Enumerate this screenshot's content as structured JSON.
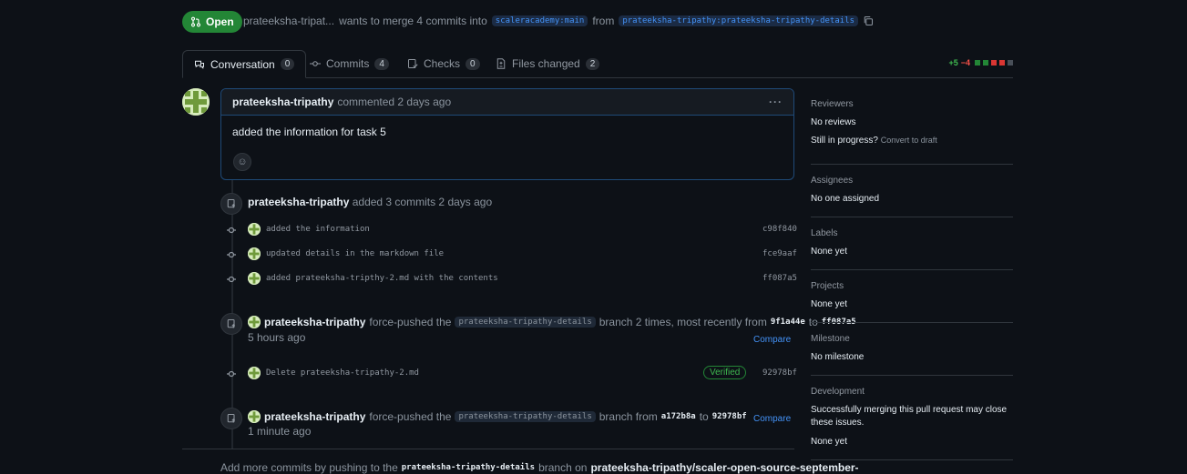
{
  "header": {
    "state": "Open",
    "author": "prateeksha-tripat...",
    "merge_text": "wants to merge 4 commits into",
    "base_branch": "scaleracademy:main",
    "from_text": "from",
    "head_branch": "prateeksha-tripathy:prateeksha-tripathy-details"
  },
  "tabs": [
    {
      "label": "Conversation",
      "count": "0"
    },
    {
      "label": "Commits",
      "count": "4"
    },
    {
      "label": "Checks",
      "count": "0"
    },
    {
      "label": "Files changed",
      "count": "2"
    }
  ],
  "diffstat": {
    "additions": "+5",
    "deletions": "−4"
  },
  "comment": {
    "author": "prateeksha-tripathy",
    "meta": "commented 2 days ago",
    "body": "added the information for task 5"
  },
  "commit_group": {
    "author": "prateeksha-tripathy",
    "meta": "added 3 commits 2 days ago",
    "commits": [
      {
        "message": "added the information",
        "sha": "c98f840"
      },
      {
        "message": "updated details in the markdown file",
        "sha": "fce9aaf"
      },
      {
        "message": "added prateeksha-tripthy-2.md with the contents",
        "sha": "ff087a5"
      }
    ]
  },
  "force_push_1": {
    "author": "prateeksha-tripathy",
    "action": "force-pushed the",
    "branch": "prateeksha-tripathy-details",
    "middle": "branch 2 times, most recently from",
    "from_sha": "9f1a44e",
    "to_text": "to",
    "to_sha": "ff087a5",
    "time": "5 hours ago",
    "compare": "Compare"
  },
  "single_commit": {
    "message": "Delete prateeksha-tripathy-2.md",
    "verified": "Verified",
    "sha": "92978bf"
  },
  "force_push_2": {
    "author": "prateeksha-tripathy",
    "action": "force-pushed the",
    "branch": "prateeksha-tripathy-details",
    "middle": "branch from",
    "from_sha": "a172b8a",
    "to_text": "to",
    "to_sha": "92978bf",
    "time": "1 minute ago",
    "compare": "Compare"
  },
  "footer_note": {
    "prefix": "Add more commits by pushing to the",
    "branch": "prateeksha-tripathy-details",
    "middle": "branch on",
    "repo": "prateeksha-tripathy/scaler-open-source-september-"
  },
  "sidebar": {
    "reviewers": {
      "title": "Reviewers",
      "value": "No reviews",
      "progress": "Still in progress?",
      "convert": "Convert to draft"
    },
    "assignees": {
      "title": "Assignees",
      "value": "No one assigned"
    },
    "labels": {
      "title": "Labels",
      "value": "None yet"
    },
    "projects": {
      "title": "Projects",
      "value": "None yet"
    },
    "milestone": {
      "title": "Milestone",
      "value": "No milestone"
    },
    "development": {
      "title": "Development",
      "value": "Successfully merging this pull request may close these issues.",
      "none": "None yet"
    }
  },
  "colors": {
    "open_green": "#238636",
    "link_blue": "#4493f8",
    "bg": "#0d1117",
    "addition": "#3fb950",
    "deletion": "#f85149"
  }
}
